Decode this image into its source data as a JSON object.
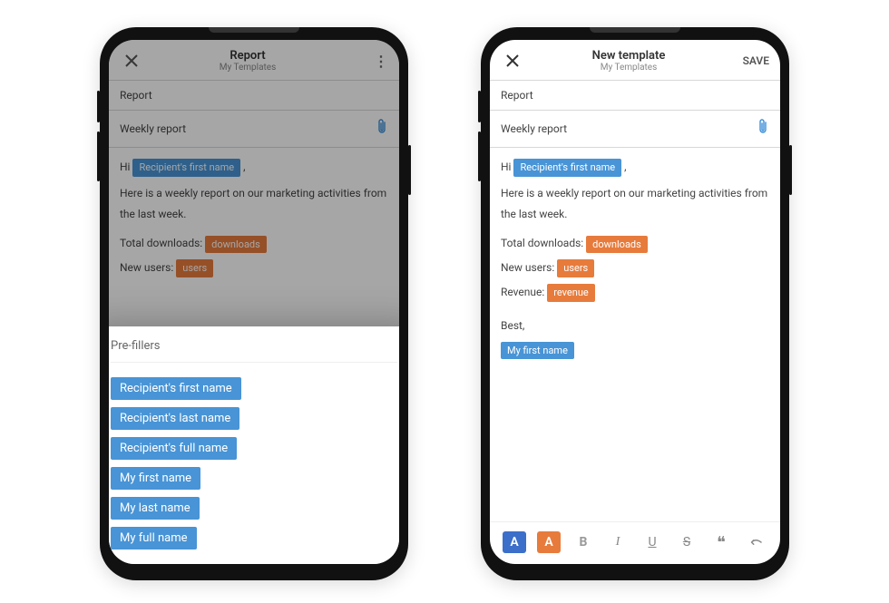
{
  "left": {
    "header": {
      "title": "Report",
      "subtitle": "My Templates"
    },
    "name_field": "Report",
    "subject_field": "Weekly report",
    "body": {
      "greeting_prefix": "Hi",
      "greeting_chip": "Recipient's first name",
      "greeting_suffix": ",",
      "para1": "Here is a weekly report on our marketing activities from the last week.",
      "downloads_label": "Total downloads:",
      "downloads_chip": "downloads",
      "users_label": "New users:",
      "users_chip": "users"
    },
    "sheet": {
      "title": "Pre-fillers",
      "items": [
        "Recipient's first name",
        "Recipient's last name",
        "Recipient's full name",
        "My first name",
        "My last name",
        "My full name"
      ]
    }
  },
  "right": {
    "header": {
      "title": "New template",
      "subtitle": "My Templates",
      "save": "SAVE"
    },
    "name_field": "Report",
    "subject_field": "Weekly report",
    "body": {
      "greeting_prefix": "Hi",
      "greeting_chip": "Recipient's first name",
      "greeting_suffix": ",",
      "para1": "Here is a weekly report on our marketing activities from the last week.",
      "downloads_label": "Total downloads:",
      "downloads_chip": "downloads",
      "users_label": "New users:",
      "users_chip": "users",
      "revenue_label": "Revenue:",
      "revenue_chip": "revenue",
      "signoff": "Best,",
      "sig_chip": "My first name"
    },
    "toolbar": {
      "color_a": "A",
      "highlight_a": "A",
      "bold": "B",
      "italic": "I",
      "underline": "U",
      "strike": "S",
      "quote": "❝"
    }
  }
}
